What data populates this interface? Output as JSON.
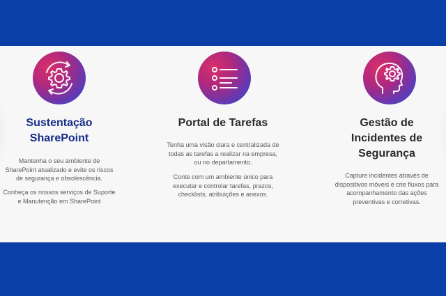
{
  "cards": [
    {
      "title_lines": [
        "Sustentação",
        "SharePoint"
      ],
      "icon": "gear-sync-icon",
      "paragraphs": [
        [
          "Mantenha o seu ambiente de",
          "SharePoint atualizado e evite os riscos",
          "de segurança e obsolescência."
        ],
        [
          "Conheça os nossos serviços de Suporte",
          "e Manutenção em SharePoint"
        ]
      ]
    },
    {
      "title_lines": [
        "Portal de Tarefas"
      ],
      "icon": "task-list-icon",
      "paragraphs": [
        [
          "Tenha uma visão clara e centralizada de",
          "todas as tarefas a realizar na empresa,",
          "ou no departamento."
        ],
        [
          "Conte com um ambiente único para",
          "executar e controlar tarefas, prazos,",
          "checklists, atribuições e anexos."
        ]
      ]
    },
    {
      "title_lines": [
        "Gestão de",
        "Incidentes de",
        "Segurança"
      ],
      "icon": "head-gear-icon",
      "paragraphs": [
        [
          "Capture incidentes através de",
          "dispositivos móveis e crie fluxos para",
          "acompanhamento das ações",
          "preventivas e corretivas."
        ]
      ]
    }
  ],
  "colors": {
    "band": "#0a3fa8",
    "panel": "#f7f7f8",
    "title_accent": "#152b86",
    "title": "#2a2a2a",
    "body_text": "#5a5a5a"
  }
}
